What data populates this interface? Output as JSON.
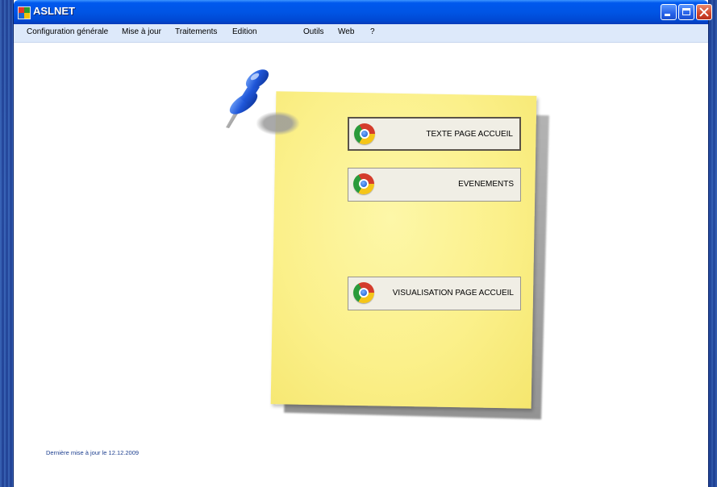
{
  "window": {
    "title": "ASLNET"
  },
  "menubar": {
    "items": [
      "Configuration générale",
      "Mise à jour",
      "Traitements",
      "Edition",
      "Outils",
      "Web",
      "?"
    ]
  },
  "buttons": [
    {
      "label": "TEXTE PAGE ACCUEIL",
      "icon": "chrome-icon",
      "focused": true
    },
    {
      "label": "EVENEMENTS",
      "icon": "chrome-icon",
      "focused": false
    },
    {
      "label": "VISUALISATION PAGE ACCUEIL",
      "icon": "chrome-icon",
      "focused": false
    }
  ],
  "footer": {
    "last_update": "Dernière mise à jour le 12.12.2009"
  },
  "colors": {
    "note": "#fbf08a",
    "titlebar": "#0055e5",
    "menubar": "#dde9fa",
    "footer_text": "#1d3f8f"
  }
}
